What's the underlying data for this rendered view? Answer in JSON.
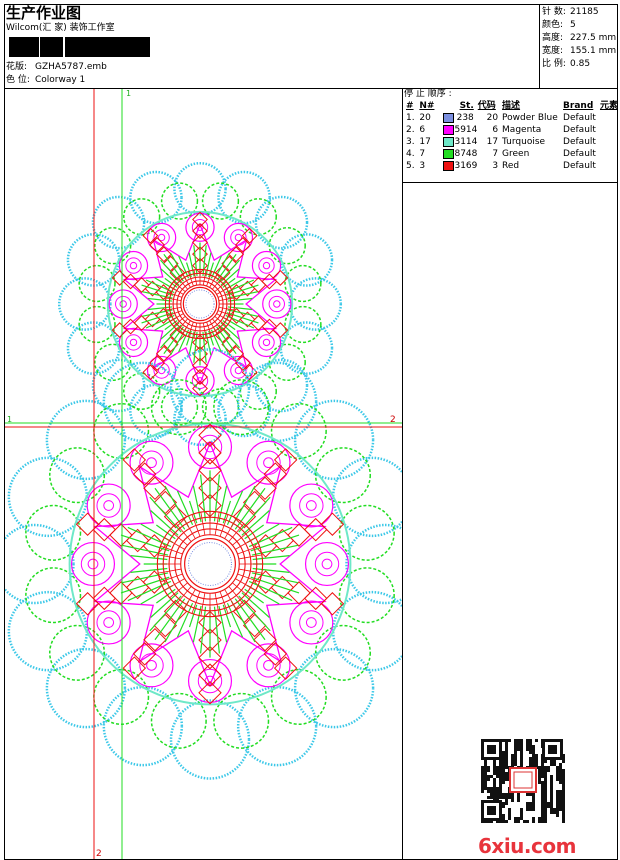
{
  "header": {
    "title": "生产作业图",
    "studio": "Wilcom(汇 家) 装饰工作室",
    "design_label": "花版:",
    "design_value": "GZHA5787.emb",
    "colorway_label": "色 位:",
    "colorway_value": "Colorway 1"
  },
  "stats": [
    {
      "label": "针 数:",
      "value": "21185"
    },
    {
      "label": "颜色:",
      "value": "5"
    },
    {
      "label": "高度:",
      "value": "227.5 mm"
    },
    {
      "label": "宽度:",
      "value": "155.1 mm"
    },
    {
      "label": "比 例:",
      "value": "0.85"
    }
  ],
  "stop_sequence": {
    "title": "停 止 顺序 :",
    "headers": {
      "num": "#",
      "n": "N#",
      "st": "St.",
      "code": "代码",
      "desc": "描述",
      "brand": "Brand",
      "element": "元素"
    },
    "rows": [
      {
        "idx": "1.",
        "n": "20",
        "color": "#7b8fe0",
        "st": "238",
        "code": "20",
        "desc": "Powder Blue",
        "brand": "Default"
      },
      {
        "idx": "2.",
        "n": "6",
        "color": "#ff00ff",
        "st": "5914",
        "code": "6",
        "desc": "Magenta",
        "brand": "Default"
      },
      {
        "idx": "3.",
        "n": "17",
        "color": "#6ee8c8",
        "st": "3114",
        "code": "17",
        "desc": "Turquoise",
        "brand": "Default"
      },
      {
        "idx": "4.",
        "n": "7",
        "color": "#22dd22",
        "st": "8748",
        "code": "7",
        "desc": "Green",
        "brand": "Default"
      },
      {
        "idx": "5.",
        "n": "3",
        "color": "#ee1111",
        "st": "3169",
        "code": "3",
        "desc": "Red",
        "brand": "Default"
      }
    ]
  },
  "guides": {
    "green_top": "1",
    "green_left": "1",
    "red_right": "2",
    "red_bottom": "2"
  },
  "watermark": "6xiu.com",
  "colors": {
    "powder_blue": "#7b8fe0",
    "magenta": "#ff00ff",
    "turquoise": "#6ee8c8",
    "green": "#22dd22",
    "red": "#ee1111",
    "cyan": "#3cc8e8"
  }
}
